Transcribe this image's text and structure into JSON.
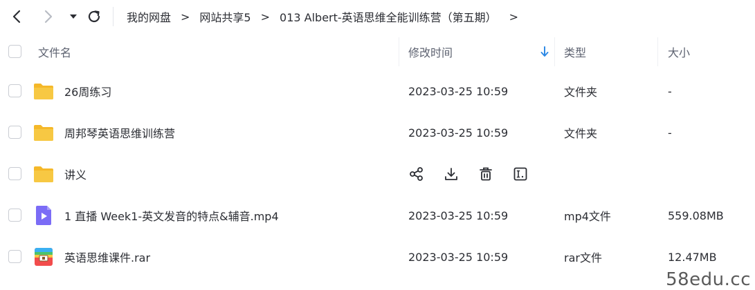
{
  "nav": {
    "breadcrumb": [
      "我的网盘",
      "网站共享5",
      "013 Albert-英语思维全能训练营（第五期）"
    ],
    "separator": ">",
    "trailing_separator": ">"
  },
  "table": {
    "headers": {
      "name": "文件名",
      "modified": "修改时间",
      "type": "类型",
      "size": "大小"
    },
    "sort": {
      "column": "modified",
      "direction": "desc"
    },
    "rows": [
      {
        "name": "26周练习",
        "modified": "2023-03-25 10:59",
        "type": "文件夹",
        "size": "-",
        "icon": "folder-icon",
        "hovered": false
      },
      {
        "name": "周邦琴英语思维训练营",
        "modified": "2023-03-25 10:59",
        "type": "文件夹",
        "size": "-",
        "icon": "folder-icon",
        "hovered": false
      },
      {
        "name": "讲义",
        "modified": "",
        "type": "",
        "size": "",
        "icon": "folder-icon",
        "hovered": true
      },
      {
        "name": "1 直播 Week1-英文发音的特点&辅音.mp4",
        "modified": "2023-03-25 10:59",
        "type": "mp4文件",
        "size": "559.08MB",
        "icon": "video-file-icon",
        "hovered": false
      },
      {
        "name": "英语思维课件.rar",
        "modified": "2023-03-25 10:59",
        "type": "rar文件",
        "size": "12.47MB",
        "icon": "archive-file-icon",
        "hovered": false
      }
    ],
    "hover_actions": [
      "share-icon",
      "download-icon",
      "delete-icon",
      "rename-icon"
    ]
  },
  "colors": {
    "folder": "#f7c843",
    "video": "#7b6cf6",
    "archive_top": "#3ab0f2",
    "archive_bottom": "#f24c4c",
    "sort_arrow": "#2f8ae5",
    "text": "#2b2d33",
    "header_text": "#5d6270"
  },
  "watermark": "58edu.cc"
}
